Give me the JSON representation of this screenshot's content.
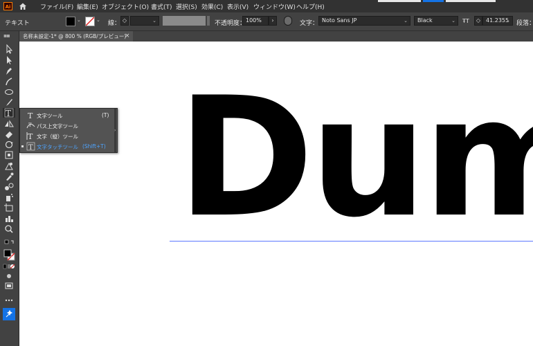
{
  "menubar": {
    "app_logo": "Ai",
    "items": [
      "ファイル(F)",
      "編集(E)",
      "オブジェクト(O)",
      "書式(T)",
      "選択(S)",
      "効果(C)",
      "表示(V)",
      "ウィンドウ(W)",
      "ヘルプ(H)"
    ]
  },
  "controlbar": {
    "selection_type": "テキスト",
    "stroke_label": "線：",
    "opacity_label": "不透明度：",
    "opacity_value": "100%",
    "character_label": "文字：",
    "font_family": "Noto Sans JP",
    "font_style": "Black",
    "font_size": "41.2355",
    "paragraph_label": "段落："
  },
  "document_tab": {
    "title": "名称未設定-1* @ 800 % (RGB/プレビュー)",
    "close": "×"
  },
  "artboard": {
    "text": "Dum"
  },
  "type_tool_flyout": {
    "items": [
      {
        "label": "文字ツール",
        "shortcut": "(T)",
        "icon": "type-tool-icon"
      },
      {
        "label": "パス上文字ツール",
        "shortcut": "",
        "icon": "type-on-path-icon"
      },
      {
        "label": "文字（縦）ツール",
        "shortcut": "",
        "icon": "vertical-type-icon"
      },
      {
        "label": "文字タッチツール",
        "shortcut": "(Shift+T)",
        "icon": "touch-type-icon"
      }
    ],
    "selected_index": 3
  },
  "colors": {
    "menubar_bg": "#323232",
    "panel_bg": "#424242",
    "workspace_bg": "#535353",
    "accent_blue": "#4ea4ff",
    "baseline_blue": "#5b78ff",
    "ai_orange": "#ff7c00"
  }
}
